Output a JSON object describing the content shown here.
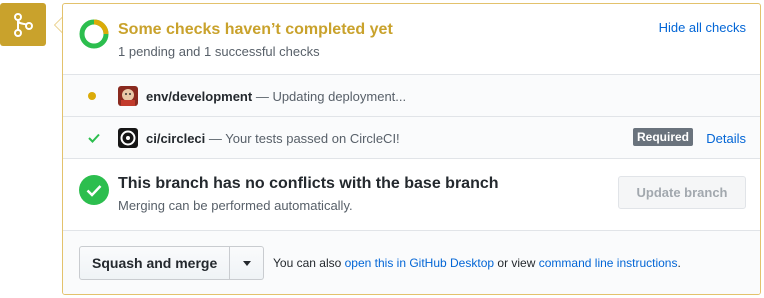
{
  "merge_badge": {
    "icon": "git-merge-icon",
    "color": "#c9a22c"
  },
  "header": {
    "title": "Some checks haven’t completed yet",
    "subtitle": "1 pending and 1 successful checks",
    "hide_link": "Hide all checks",
    "title_color": "#c9a22c"
  },
  "checks": [
    {
      "status": "pending",
      "name": "env/development",
      "description": "— Updating deployment..."
    },
    {
      "status": "success",
      "name": "ci/circleci",
      "description": "— Your tests passed on CircleCI!",
      "badge": "Required",
      "details": "Details"
    }
  ],
  "conflict": {
    "title": "This branch has no conflicts with the base branch",
    "subtitle": "Merging can be performed automatically.",
    "update_button": "Update branch"
  },
  "footer": {
    "merge_button": "Squash and merge",
    "text_before": "You can also",
    "desktop_link": "open this in GitHub Desktop",
    "text_middle": "or view",
    "cli_link": "command line instructions",
    "text_after": "."
  },
  "colors": {
    "pending": "#dbab09",
    "success": "#2cbe4e",
    "link": "#0366d6",
    "required_badge": "#6a737d"
  }
}
